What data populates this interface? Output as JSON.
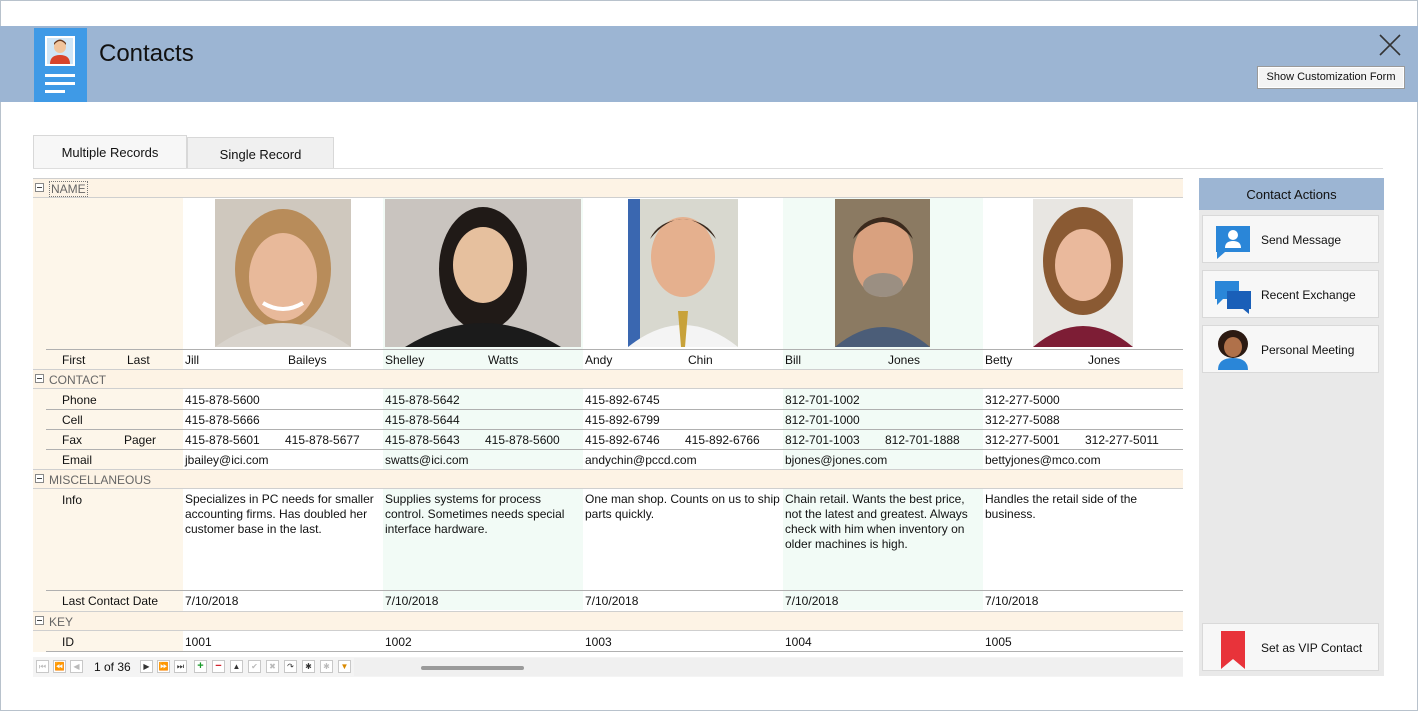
{
  "window": {
    "title": "Contacts",
    "customize_label": "Show Customization Form"
  },
  "tabs": [
    {
      "label": "Multiple Records"
    },
    {
      "label": "Single Record"
    }
  ],
  "sections": {
    "name": "NAME",
    "contact": "CONTACT",
    "misc": "MISCELLANEOUS",
    "key": "KEY"
  },
  "labels": {
    "first": "First",
    "last": "Last",
    "phone": "Phone",
    "cell": "Cell",
    "fax": "Fax",
    "pager": "Pager",
    "email": "Email",
    "info": "Info",
    "last_contact": "Last Contact Date",
    "id": "ID"
  },
  "contacts": [
    {
      "first": "Jill",
      "last": "Baileys",
      "phone": "415-878-5600",
      "cell": "415-878-5666",
      "fax": "415-878-5601",
      "pager": "415-878-5677",
      "email": "jbailey@ici.com",
      "info": "Specializes in PC needs for smaller accounting firms. Has doubled her customer base in the last.",
      "last_contact": "7/10/2018",
      "id": "1001"
    },
    {
      "first": "Shelley",
      "last": "Watts",
      "phone": "415-878-5642",
      "cell": "415-878-5644",
      "fax": "415-878-5643",
      "pager": "415-878-5600",
      "email": "swatts@ici.com",
      "info": "Supplies systems for process control. Sometimes needs special interface hardware.",
      "last_contact": "7/10/2018",
      "id": "1002"
    },
    {
      "first": "Andy",
      "last": "Chin",
      "phone": "415-892-6745",
      "cell": "415-892-6799",
      "fax": "415-892-6746",
      "pager": "415-892-6766",
      "email": "andychin@pccd.com",
      "info": "One man shop. Counts on us to ship parts quickly.",
      "last_contact": "7/10/2018",
      "id": "1003"
    },
    {
      "first": "Bill",
      "last": "Jones",
      "phone": "812-701-1002",
      "cell": "812-701-1000",
      "fax": "812-701-1003",
      "pager": "812-701-1888",
      "email": "bjones@jones.com",
      "info": "Chain retail. Wants the best price, not the latest and greatest. Always check with him when inventory on older machines is high.",
      "last_contact": "7/10/2018",
      "id": "1004"
    },
    {
      "first": "Betty",
      "last": "Jones",
      "phone": "312-277-5000",
      "cell": "312-277-5088",
      "fax": "312-277-5001",
      "pager": "312-277-5011",
      "email": "bettyjones@mco.com",
      "info": "Handles the retail side of the business.",
      "last_contact": "7/10/2018",
      "id": "1005"
    }
  ],
  "pager": {
    "text": "1 of 36"
  },
  "side": {
    "title": "Contact Actions",
    "actions": [
      {
        "label": "Send Message",
        "icon": "user-message-icon"
      },
      {
        "label": "Recent Exchange",
        "icon": "chat-bubbles-icon"
      },
      {
        "label": "Personal Meeting",
        "icon": "person-avatar-icon"
      },
      {
        "label": "Set as VIP Contact",
        "icon": "bookmark-flag-icon"
      }
    ]
  },
  "colors": {
    "header": "#9cb5d3",
    "app_icon": "#3f9ae6",
    "label_band": "#fdf6ea",
    "alt_column": "#f2fbf6",
    "vip_red": "#e8333a"
  }
}
